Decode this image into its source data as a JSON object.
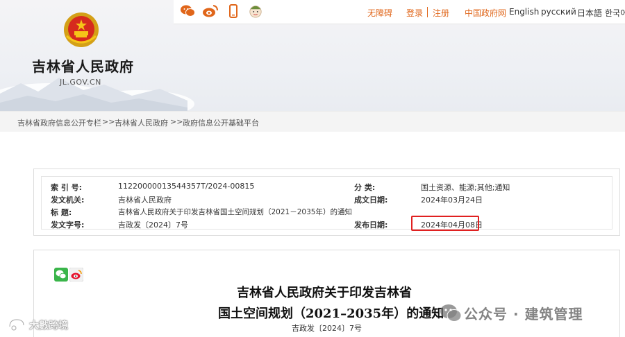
{
  "header": {
    "site_title": "吉林省人民政府",
    "site_domain": "JL.GOV.CN",
    "top_links": {
      "accessibility": "无障碍",
      "login": "登录",
      "register": "注册",
      "central_gov": "中国政府网",
      "english": "English",
      "russian": "русский",
      "japanese": "日本語",
      "korean": "한국어"
    },
    "social_icons": [
      "weixin-icon",
      "weibo-icon",
      "mobile-icon",
      "avatar-icon"
    ]
  },
  "breadcrumb": {
    "items": [
      "吉林省政府信息公开专栏",
      "吉林省人民政府",
      "政府信息公开基础平台"
    ],
    "separator": ">>"
  },
  "info": {
    "index_label": "索 引 号:",
    "index_value": "11220000013544357T/2024-00815",
    "category_label": "分    类:",
    "category_value": "国土资源、能源;其他;通知",
    "issuer_label": "发文机关:",
    "issuer_value": "吉林省人民政府",
    "created_label": "成文日期:",
    "created_value": "2024年03月24日",
    "title_label": "标      题:",
    "title_value": "吉林省人民政府关于印发吉林省国土空间规划（2021－2035年）的通知",
    "doc_no_label": "发文字号:",
    "doc_no_value": "吉政发〔2024〕7号",
    "published_label": "发布日期:",
    "published_value": "2024年04月08日",
    "highlight_color": "#e02020"
  },
  "document": {
    "title_line1": "吉林省人民政府关于印发吉林省",
    "title_line2": "国土空间规划（2021–2035年）的通知",
    "number": "吉政发〔2024〕7号",
    "share_icons": [
      "wechat-share-icon",
      "weibo-share-icon"
    ]
  },
  "watermarks": {
    "right": "公众号 · 建筑管理",
    "left": "大數跨境"
  },
  "colors": {
    "accent": "#e0661a",
    "highlight": "#e02020",
    "weixin": "#3ab54a",
    "weibo": "#e6162d"
  }
}
